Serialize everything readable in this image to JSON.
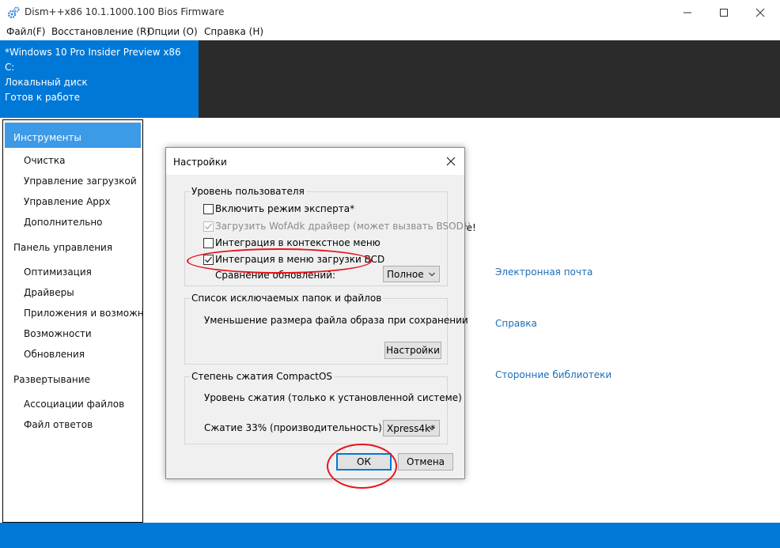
{
  "window": {
    "title": "Dism++x86 10.1.1000.100 Bios Firmware",
    "icon": "gear-icon",
    "controls": [
      "minimize-icon",
      "maximize-icon",
      "close-icon"
    ]
  },
  "menu": {
    "file": "Файл(F)",
    "restore": "Восстановление (R)",
    "options": "Опции (O)",
    "help": "Справка (H)"
  },
  "image_info": {
    "os": "*Windows 10 Pro Insider Preview x86",
    "drive": "C:",
    "disk": "Локальный диск",
    "status": "Готов к работе"
  },
  "sidebar": {
    "tools": "Инструменты",
    "tools_items": [
      "Очистка",
      "Управление загрузкой",
      "Управление Appx",
      "Дополнительно"
    ],
    "control_panel": "Панель управления",
    "control_items": [
      "Оптимизация",
      "Драйверы",
      "Приложения и возможнос",
      "Возможности",
      "Обновления"
    ],
    "deploy": "Развертывание",
    "deploy_items": [
      "Ассоциации файлов",
      "Файл ответов"
    ]
  },
  "main": {
    "partial_text": "re!",
    "links": {
      "email": "Электронная почта",
      "help": "Справка",
      "libs": "Сторонние библиотеки"
    }
  },
  "dialog": {
    "title": "Настройки",
    "user_level": {
      "title": "Уровень пользователя",
      "expert_mode": {
        "label": "Включить режим эксперта*",
        "checked": false,
        "enabled": true
      },
      "wofadk": {
        "label": "Загрузить WofAdk драйвер (может вызвать BSOD!)",
        "checked": true,
        "enabled": false
      },
      "context_menu": {
        "label": "Интеграция в контекстное меню",
        "checked": false,
        "enabled": true
      },
      "boot_menu": {
        "label": "Интеграция в меню загрузки BCD",
        "checked": true,
        "enabled": true
      },
      "compare_updates_label": "Сравнение обновлений:",
      "compare_updates_value": "Полное"
    },
    "exclusions": {
      "title": "Список исключаемых папок и файлов",
      "description": "Уменьшение размера файла образа при сохранении",
      "settings_button": "Настройки"
    },
    "compact": {
      "title": "Степень сжатия CompactOS",
      "level_text": "Уровень сжатия (только к установленной системе)",
      "ratio_text": "Сжатие 33% (производительность)",
      "algo_value": "Xpress4k*"
    },
    "ok": "ОК",
    "cancel": "Отмена"
  },
  "colors": {
    "accent": "#0078d7",
    "dark_panel": "#2b2b2b",
    "nav_selected": "#3c9ae6",
    "link": "#1d6fb8",
    "annotation": "#e8141c"
  }
}
